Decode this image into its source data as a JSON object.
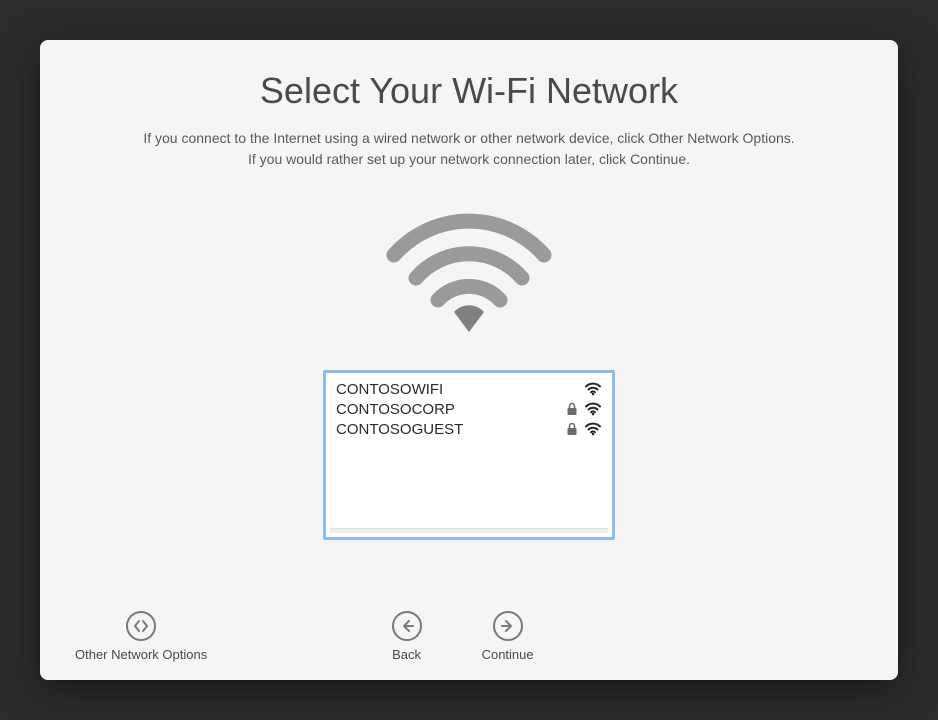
{
  "title": "Select Your Wi-Fi Network",
  "subtitle": "If you connect to the Internet using a wired network or other network device, click Other Network Options. If you would rather set up your network connection later, click Continue.",
  "networks": [
    {
      "name": "CONTOSOWIFI",
      "locked": false
    },
    {
      "name": "CONTOSOCORP",
      "locked": true
    },
    {
      "name": "CONTOSOGUEST",
      "locked": true
    }
  ],
  "footer": {
    "other_label": "Other Network Options",
    "back_label": "Back",
    "continue_label": "Continue"
  }
}
